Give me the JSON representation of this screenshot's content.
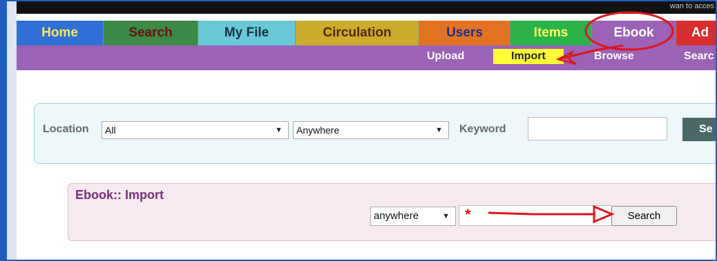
{
  "header": {
    "note": "wan to acces"
  },
  "tabs": [
    {
      "label": "Home",
      "bg": "#2f6fd6",
      "color": "#f7e85a"
    },
    {
      "label": "Search",
      "bg": "#3b8a45",
      "color": "#6a1010"
    },
    {
      "label": "My File",
      "bg": "#69c8d6",
      "color": "#163446"
    },
    {
      "label": "Circulation",
      "bg": "#c9ac2c",
      "color": "#55290a"
    },
    {
      "label": "Users",
      "bg": "#e37223",
      "color": "#1c2f8c"
    },
    {
      "label": "Items",
      "bg": "#2bb34a",
      "color": "#ffff66"
    },
    {
      "label": "Ebook",
      "bg": "#9b62b5",
      "color": "#ffffff"
    },
    {
      "label": "Ad",
      "bg": "#d72e2e",
      "color": "#ffffff"
    }
  ],
  "subnav": [
    {
      "label": "Upload"
    },
    {
      "label": "Import"
    },
    {
      "label": "Browse"
    },
    {
      "label": "Searc"
    }
  ],
  "search": {
    "location_label": "Location",
    "location_value": "All",
    "scope_value": "Anywhere",
    "keyword_label": "Keyword",
    "keyword_value": "",
    "button_label": "Se"
  },
  "import": {
    "title": "Ebook:: Import",
    "scope_value": "anywhere",
    "required_mark": "*",
    "query_value": "",
    "button_label": "Search"
  },
  "colors": {
    "annotation": "#e0141c",
    "subnav_bg": "#9b62b5",
    "active_highlight": "#ffff33"
  }
}
